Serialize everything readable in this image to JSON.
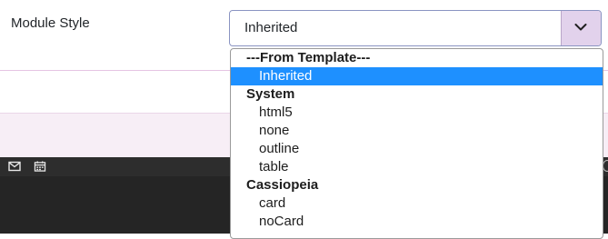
{
  "field": {
    "label": "Module Style",
    "selected_value": "Inherited"
  },
  "dropdown": {
    "groups": [
      {
        "label": "---From Template---",
        "options": [
          "Inherited"
        ]
      },
      {
        "label": "System",
        "options": [
          "html5",
          "none",
          "outline",
          "table"
        ]
      },
      {
        "label": "Cassiopeia",
        "options": [
          "card",
          "noCard"
        ]
      }
    ],
    "highlighted_option": "Inherited"
  },
  "colors": {
    "select_border": "#8a94c2",
    "arrow_button_bg": "#e2d2ec",
    "highlight": "#1e90ff",
    "pink_band": "#f7eef6",
    "editor_toolbar": "#2d2d2d",
    "editor_area": "#252525"
  },
  "icons": {
    "select_arrow": "chevron-down-icon",
    "toolbar": [
      "envelope-icon",
      "calendar-icon"
    ]
  }
}
